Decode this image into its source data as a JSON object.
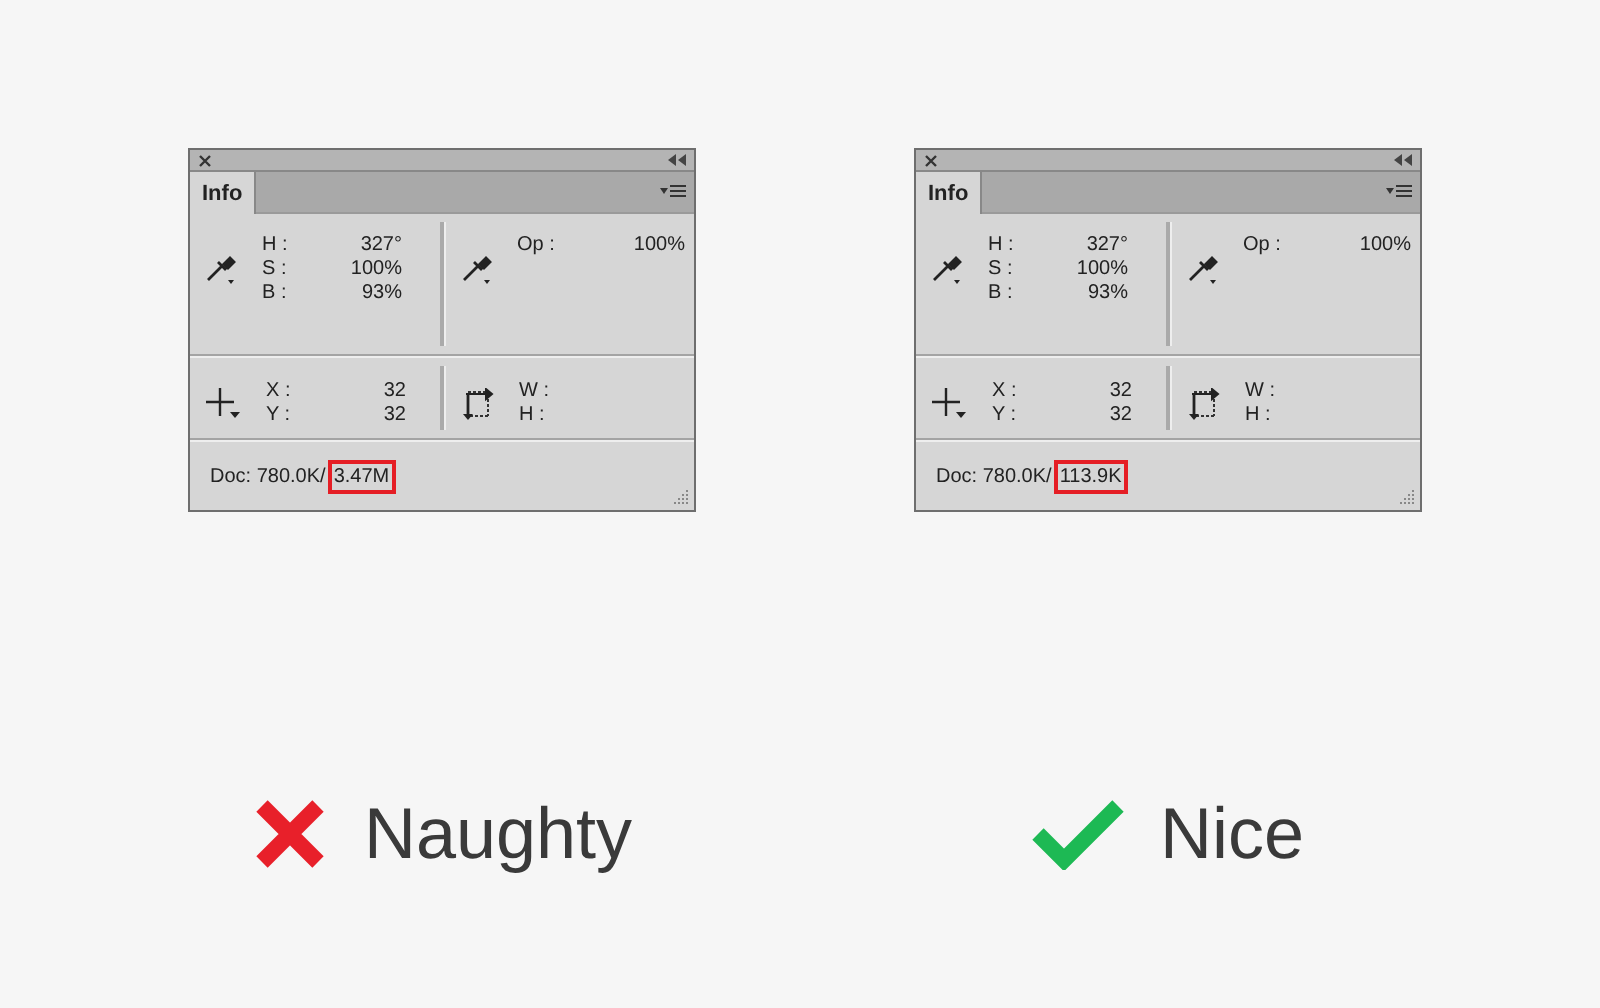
{
  "columns": [
    {
      "panel": {
        "tabs": [
          {
            "label": "Info",
            "selected": true
          }
        ],
        "color_readout": [
          {
            "label": "H :",
            "value": "327°"
          },
          {
            "label": "S :",
            "value": "100%"
          },
          {
            "label": "B :",
            "value": "93%"
          }
        ],
        "opacity": {
          "label": "Op :",
          "value": "100%"
        },
        "position": [
          {
            "label": "X :",
            "value": "32"
          },
          {
            "label": "Y :",
            "value": "32"
          }
        ],
        "size": [
          {
            "label": "W :"
          },
          {
            "label": "H :"
          }
        ],
        "doc": {
          "text": "Doc: 780.0K/",
          "highlight": "3.47M"
        }
      },
      "verdict": {
        "kind": "bad",
        "label": "Naughty"
      }
    },
    {
      "panel": {
        "tabs": [
          {
            "label": "Info",
            "selected": true
          }
        ],
        "color_readout": [
          {
            "label": "H :",
            "value": "327°"
          },
          {
            "label": "S :",
            "value": "100%"
          },
          {
            "label": "B :",
            "value": "93%"
          }
        ],
        "opacity": {
          "label": "Op :",
          "value": "100%"
        },
        "position": [
          {
            "label": "X :",
            "value": "32"
          },
          {
            "label": "Y :",
            "value": "32"
          }
        ],
        "size": [
          {
            "label": "W :"
          },
          {
            "label": "H :"
          }
        ],
        "doc": {
          "text": "Doc: 780.0K/",
          "highlight": "113.9K"
        }
      },
      "verdict": {
        "kind": "good",
        "label": "Nice"
      }
    }
  ]
}
